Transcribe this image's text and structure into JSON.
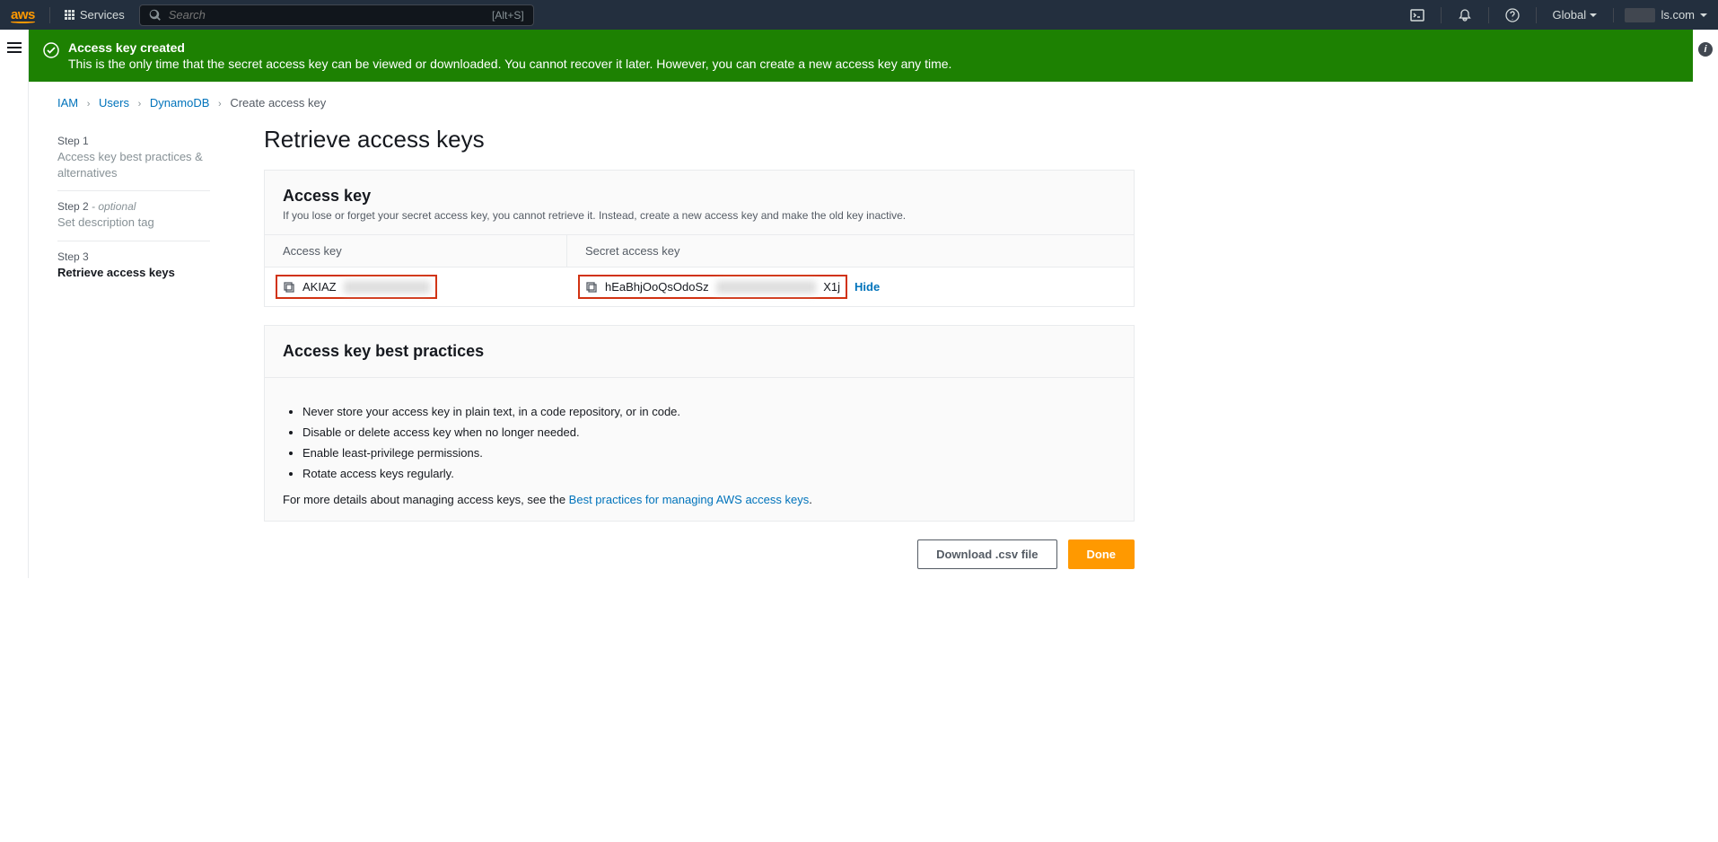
{
  "nav": {
    "logo_text": "aws",
    "services_label": "Services",
    "search_placeholder": "Search",
    "search_shortcut": "[Alt+S]",
    "region": "Global",
    "account_suffix": "ls.com"
  },
  "alert": {
    "title": "Access key created",
    "message": "This is the only time that the secret access key can be viewed or downloaded. You cannot recover it later. However, you can create a new access key any time."
  },
  "breadcrumb": {
    "items": [
      "IAM",
      "Users",
      "DynamoDB"
    ],
    "current": "Create access key"
  },
  "steps": [
    {
      "num": "Step 1",
      "title": "Access key best practices & alternatives",
      "optional": false
    },
    {
      "num": "Step 2",
      "title": "Set description tag",
      "optional": true
    },
    {
      "num": "Step 3",
      "title": "Retrieve access keys",
      "optional": false
    }
  ],
  "heading": "Retrieve access keys",
  "access_panel": {
    "title": "Access key",
    "desc": "If you lose or forget your secret access key, you cannot retrieve it. Instead, create a new access key and make the old key inactive.",
    "col1": "Access key",
    "col2": "Secret access key",
    "access_key_prefix": "AKIAZ",
    "secret_prefix": "hEaBhjOoQsOdoSz",
    "secret_suffix": "X1j",
    "hide_label": "Hide"
  },
  "bp_panel": {
    "title": "Access key best practices",
    "items": [
      "Never store your access key in plain text, in a code repository, or in code.",
      "Disable or delete access key when no longer needed.",
      "Enable least-privilege permissions.",
      "Rotate access keys regularly."
    ],
    "more_prefix": "For more details about managing access keys, see the ",
    "more_link": "Best practices for managing AWS access keys"
  },
  "actions": {
    "download": "Download .csv file",
    "done": "Done"
  }
}
